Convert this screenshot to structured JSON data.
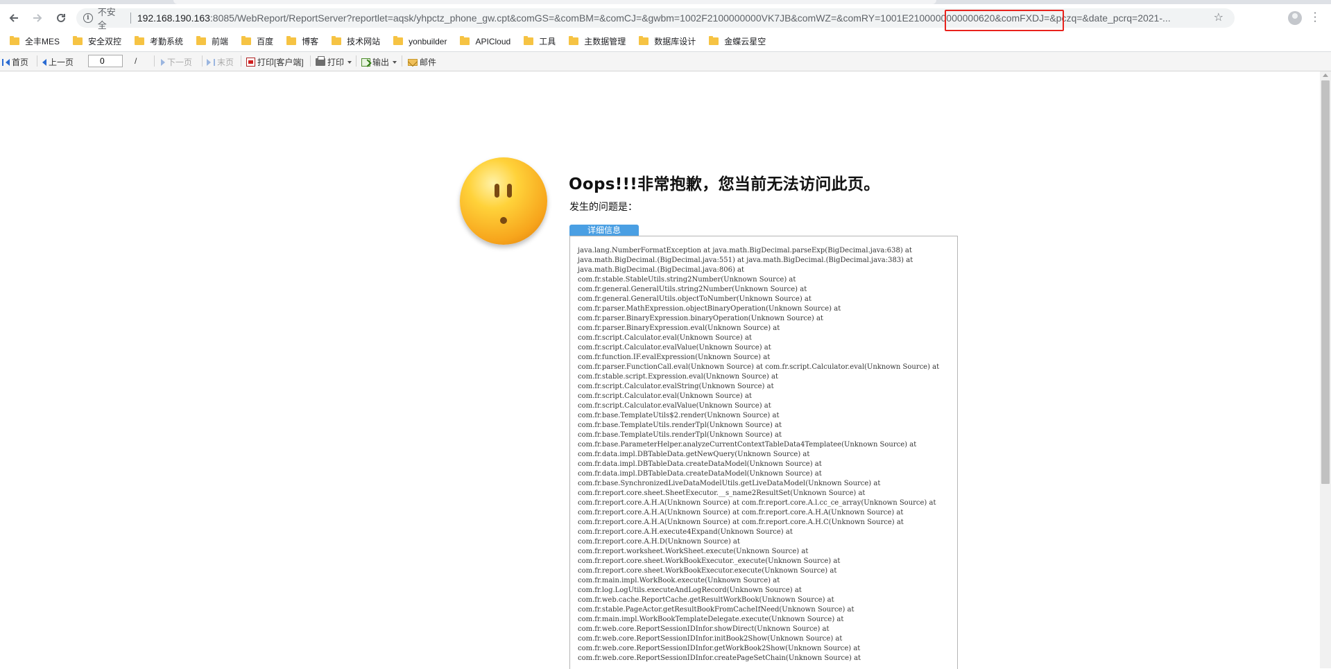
{
  "browser": {
    "url_insecure_label": "不安全",
    "url_host": "192.168.190.163",
    "url_rest": ":8085/WebReport/ReportServer?reportlet=aqsk/yhpctz_phone_gw.cpt&comGS=&comBM=&comCJ=&gwbm=1002F2100000000VK7JB&comWZ=&comRY=1001E2100000000000620&comFXDJ=&pczq=&date_pcrq=2021-..."
  },
  "bookmarks": [
    "全丰MES",
    "安全双控",
    "考勤系统",
    "前端",
    "百度",
    "博客",
    "技术网站",
    "yonbuilder",
    "APICloud",
    "工具",
    "主数据管理",
    "数据库设计",
    "金蝶云星空"
  ],
  "report_toolbar": {
    "first": "首页",
    "prev": "上一页",
    "page_value": "0",
    "page_sep": "/",
    "next": "下一页",
    "last": "末页",
    "print_client": "打印[客户端]",
    "print": "打印",
    "export": "输出",
    "mail": "邮件"
  },
  "error": {
    "title": "Oops!!!非常抱歉，您当前无法访问此页。",
    "problem_label": "发生的问题是：",
    "detail_tab": "详细信息",
    "stack_trace": "java.lang.NumberFormatException at java.math.BigDecimal.parseExp(BigDecimal.java:638) at java.math.BigDecimal.(BigDecimal.java:551) at java.math.BigDecimal.(BigDecimal.java:383) at java.math.BigDecimal.(BigDecimal.java:806) at\ncom.fr.stable.StableUtils.string2Number(Unknown Source) at\ncom.fr.general.GeneralUtils.string2Number(Unknown Source) at\ncom.fr.general.GeneralUtils.objectToNumber(Unknown Source) at\ncom.fr.parser.MathExpression.objectBinaryOperation(Unknown Source) at\ncom.fr.parser.BinaryExpression.binaryOperation(Unknown Source) at\ncom.fr.parser.BinaryExpression.eval(Unknown Source) at\ncom.fr.script.Calculator.eval(Unknown Source) at\ncom.fr.script.Calculator.evalValue(Unknown Source) at\ncom.fr.function.IF.evalExpression(Unknown Source) at\ncom.fr.parser.FunctionCall.eval(Unknown Source) at com.fr.script.Calculator.eval(Unknown Source) at com.fr.stable.script.Expression.eval(Unknown Source) at\ncom.fr.script.Calculator.evalString(Unknown Source) at\ncom.fr.script.Calculator.eval(Unknown Source) at\ncom.fr.script.Calculator.evalValue(Unknown Source) at\ncom.fr.base.TemplateUtils$2.render(Unknown Source) at\ncom.fr.base.TemplateUtils.renderTpl(Unknown Source) at\ncom.fr.base.TemplateUtils.renderTpl(Unknown Source) at\ncom.fr.base.ParameterHelper.analyzeCurrentContextTableData4Templatee(Unknown Source) at\ncom.fr.data.impl.DBTableData.getNewQuery(Unknown Source) at\ncom.fr.data.impl.DBTableData.createDataModel(Unknown Source) at\ncom.fr.data.impl.DBTableData.createDataModel(Unknown Source) at\ncom.fr.base.SynchronizedLiveDataModelUtils.getLiveDataModel(Unknown Source) at\ncom.fr.report.core.sheet.SheetExecutor.__s_name2ResultSet(Unknown Source) at\ncom.fr.report.core.A.H.A(Unknown Source) at com.fr.report.core.A.l.cc_ce_array(Unknown Source) at com.fr.report.core.A.H.A(Unknown Source) at com.fr.report.core.A.H.A(Unknown Source) at com.fr.report.core.A.H.A(Unknown Source) at com.fr.report.core.A.H.C(Unknown Source) at com.fr.report.core.A.H.execute4Expand(Unknown Source) at\ncom.fr.report.core.A.H.D(Unknown Source) at\ncom.fr.report.worksheet.WorkSheet.execute(Unknown Source) at\ncom.fr.report.core.sheet.WorkBookExecutor._execute(Unknown Source) at\ncom.fr.report.core.sheet.WorkBookExecutor.execute(Unknown Source) at\ncom.fr.main.impl.WorkBook.execute(Unknown Source) at\ncom.fr.log.LogUtils.executeAndLogRecord(Unknown Source) at\ncom.fr.web.cache.ReportCache.getResultWorkBook(Unknown Source) at\ncom.fr.stable.PageActor.getResultBookFromCacheIfNeed(Unknown Source) at\ncom.fr.main.impl.WorkBookTemplateDelegate.execute(Unknown Source) at\ncom.fr.web.core.ReportSessionIDInfor.showDirect(Unknown Source) at\ncom.fr.web.core.ReportSessionIDInfor.initBook2Show(Unknown Source) at\ncom.fr.web.core.ReportSessionIDInfor.getWorkBook2Show(Unknown Source) at\ncom.fr.web.core.ReportSessionIDInfor.createPageSetChain(Unknown Source) at"
  }
}
